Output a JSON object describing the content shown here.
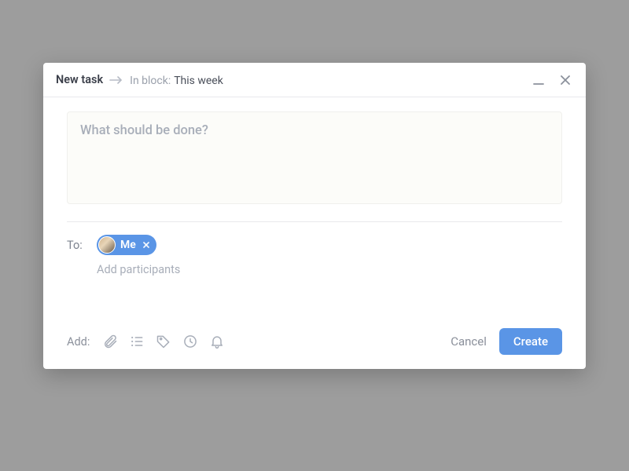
{
  "header": {
    "title": "New task",
    "block_label": "In block:",
    "block_name": "This week"
  },
  "task": {
    "placeholder": "What should be done?",
    "value": ""
  },
  "assignees": {
    "label": "To:",
    "chips": [
      {
        "name": "Me"
      }
    ],
    "hint": "Add participants"
  },
  "footer": {
    "add_label": "Add:",
    "cancel": "Cancel",
    "create": "Create"
  },
  "icons": {
    "attachment": "attachment-icon",
    "checklist": "checklist-icon",
    "tag": "tag-icon",
    "time": "time-icon",
    "reminder": "bell-icon"
  }
}
